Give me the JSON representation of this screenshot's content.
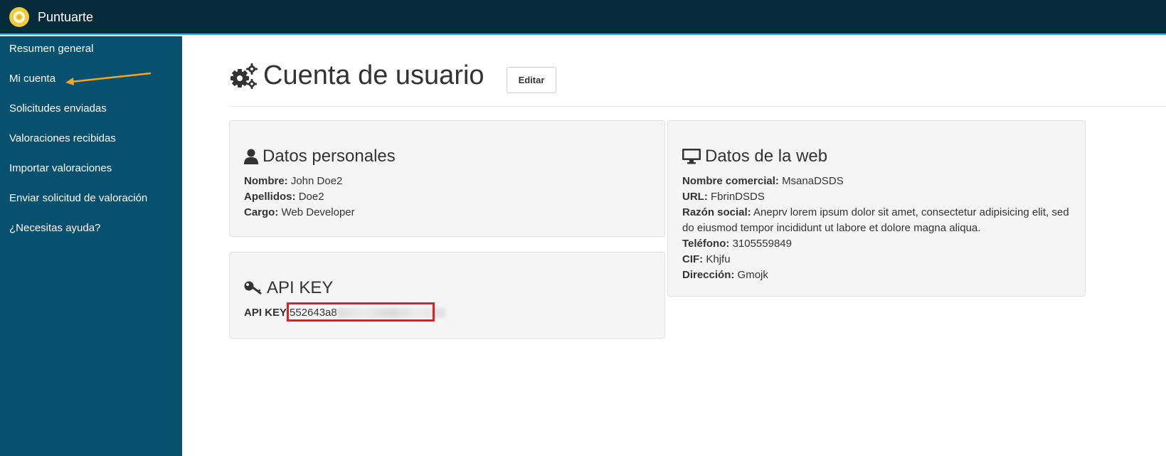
{
  "app": {
    "brand": "Puntuarte"
  },
  "sidebar": {
    "items": [
      {
        "label": "Resumen general"
      },
      {
        "label": "Mi cuenta"
      },
      {
        "label": "Solicitudes enviadas"
      },
      {
        "label": "Valoraciones recibidas"
      },
      {
        "label": "Importar valoraciones"
      },
      {
        "label": "Enviar solicitud de valoración"
      },
      {
        "label": "¿Necesitas ayuda?"
      }
    ]
  },
  "page": {
    "title": "Cuenta de usuario",
    "edit_label": "Editar"
  },
  "personal": {
    "title": "Datos personales",
    "nombre_label": "Nombre:",
    "nombre": "John Doe2",
    "apellidos_label": "Apellidos:",
    "apellidos": "Doe2",
    "cargo_label": "Cargo:",
    "cargo": "Web Developer"
  },
  "api": {
    "title": "API KEY",
    "label": "API KEY:",
    "value": "552643a8"
  },
  "web": {
    "title": "Datos de la web",
    "nombre_comercial_label": "Nombre comercial:",
    "nombre_comercial": "MsanaDSDS",
    "url_label": "URL:",
    "url": "FbrinDSDS",
    "razon_label": "Razón social:",
    "razon": "Aneprv lorem ipsum dolor sit amet, consectetur adipisicing elit, sed do eiusmod tempor incididunt ut labore et dolore magna aliqua.",
    "telefono_label": "Teléfono:",
    "telefono": "3105559849",
    "cif_label": "CIF:",
    "cif": "Khjfu",
    "direccion_label": "Dirección:",
    "direccion": "Gmojk"
  },
  "icons": {
    "logo": "target-logo-icon",
    "title": "gears-icon",
    "personal": "user-icon",
    "api": "key-icon",
    "web": "desktop-icon",
    "annotation": "arrow-annotation"
  },
  "colors": {
    "topbar": "#062b3a",
    "sidebar": "#07506e",
    "accent_line": "#1fb3e0",
    "logo": "#f1cc3c",
    "arrow": "#f5a623",
    "highlight": "#e0201b"
  }
}
